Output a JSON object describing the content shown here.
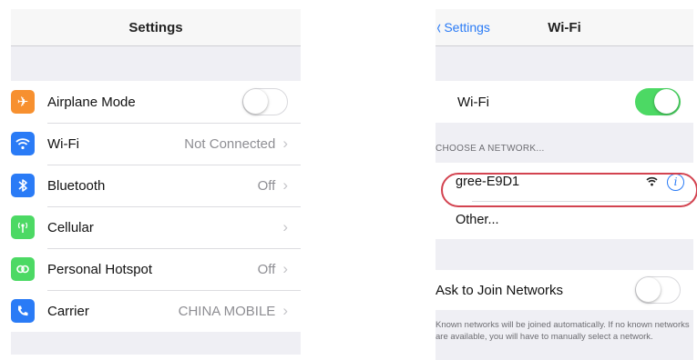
{
  "settings": {
    "title": "Settings",
    "rows": [
      {
        "label": "Airplane Mode",
        "value": "",
        "icon": "airplane-icon",
        "color": "#f7902f"
      },
      {
        "label": "Wi-Fi",
        "value": "Not Connected",
        "icon": "wifi-icon",
        "color": "#2a7bf6"
      },
      {
        "label": "Bluetooth",
        "value": "Off",
        "icon": "bluetooth-icon",
        "color": "#2a7bf6"
      },
      {
        "label": "Cellular",
        "value": "",
        "icon": "cellular-icon",
        "color": "#4cd964"
      },
      {
        "label": "Personal Hotspot",
        "value": "Off",
        "icon": "hotspot-icon",
        "color": "#4cd964"
      },
      {
        "label": "Carrier",
        "value": "CHINA MOBILE",
        "icon": "phone-icon",
        "color": "#2a7bf6"
      }
    ]
  },
  "wifi": {
    "back_label": "Settings",
    "title": "Wi-Fi",
    "wifi_label": "Wi-Fi",
    "section_header": "CHOOSE A NETWORK...",
    "networks": [
      {
        "name": "gree-E9D1"
      },
      {
        "name": "Other..."
      }
    ],
    "ask_label": "Ask to Join Networks",
    "footnote": "Known networks will be joined automatically. If no known networks are available, you will have to manually select a network."
  },
  "colors": {
    "accent": "#2a7bf6",
    "toggle_on": "#4cd964",
    "highlight": "#d34350"
  }
}
